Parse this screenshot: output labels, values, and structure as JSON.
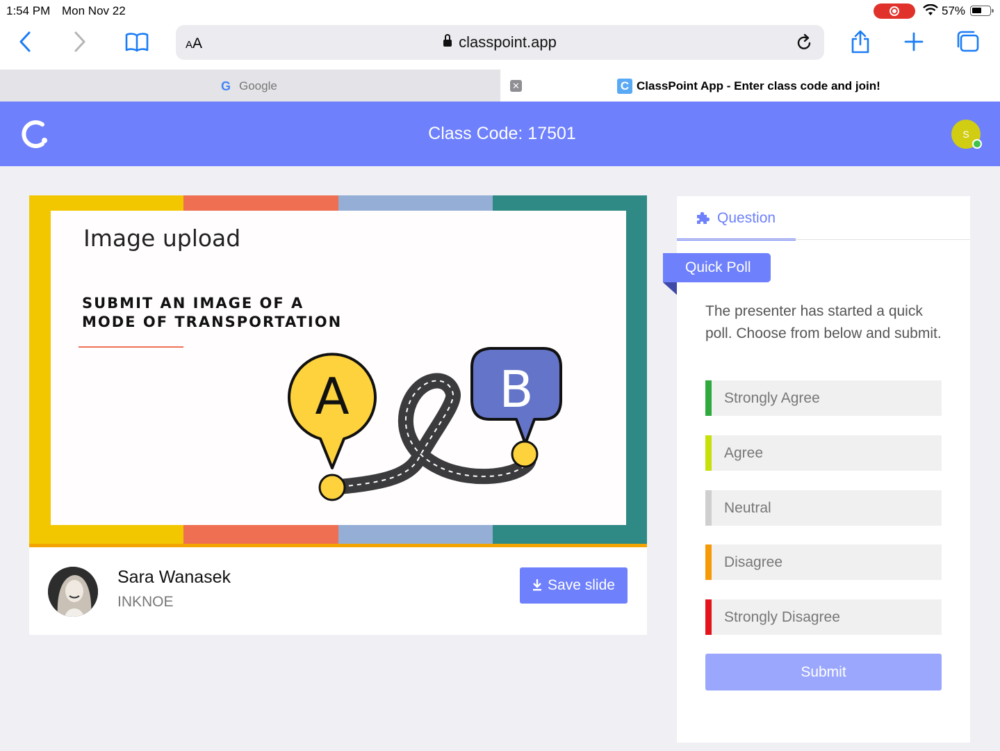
{
  "status_bar": {
    "time": "1:54 PM",
    "date": "Mon Nov 22",
    "battery_percent": "57%",
    "battery_level": 0.57,
    "recording": true
  },
  "browser": {
    "text_size_label": "AA",
    "url": "classpoint.app",
    "tabs": [
      {
        "label": "Google",
        "active": false,
        "favicon": "google-g-icon"
      },
      {
        "label": "ClassPoint App - Enter class code and join!",
        "active": true,
        "favicon": "classpoint-c-icon"
      }
    ],
    "icons": [
      "back-icon",
      "forward-icon",
      "bookmarks-icon",
      "reload-icon",
      "share-icon",
      "new-tab-icon",
      "tab-overview-icon"
    ]
  },
  "header": {
    "class_code": "Class Code: 17501",
    "avatar_initial": "S",
    "colors": {
      "brand": "#6e80fb",
      "avatar": "#d1cd12",
      "online": "#3fc24a"
    }
  },
  "slide": {
    "title": "Image upload",
    "subtitle": "SUBMIT AN IMAGE OF A MODE OF TRANSPORTATION",
    "pin_a": "A",
    "pin_b": "B",
    "frame_colors": [
      "#f2c700",
      "#ef6f53",
      "#94aed6",
      "#2f8a85"
    ]
  },
  "presenter": {
    "name": "Sara Wanasek",
    "org": "INKNOE",
    "save_label": "Save slide"
  },
  "question": {
    "tab_label": "Question",
    "type_label": "Quick Poll",
    "prompt": "The presenter has started a quick poll. Choose from below and submit.",
    "options": [
      {
        "label": "Strongly Agree",
        "color": "#2eaa3c"
      },
      {
        "label": "Agree",
        "color": "#c6e00a"
      },
      {
        "label": "Neutral",
        "color": "#cfcfcf"
      },
      {
        "label": "Disagree",
        "color": "#f79a08"
      },
      {
        "label": "Strongly Disagree",
        "color": "#e3151b"
      }
    ],
    "submit_label": "Submit"
  }
}
